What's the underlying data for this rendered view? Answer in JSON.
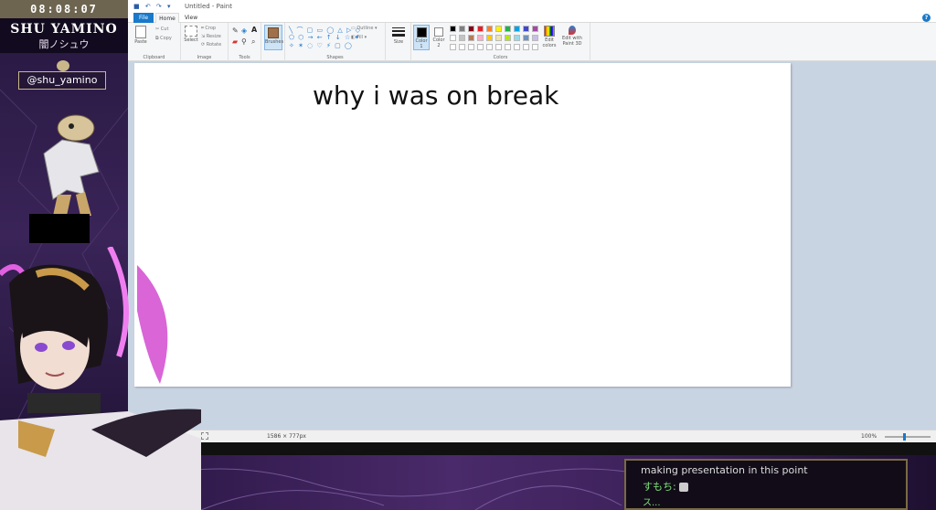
{
  "overlay": {
    "clock": "08:08:07",
    "streamer_name": "SHU YAMINO",
    "streamer_name_jp": "闇ノシュウ",
    "twitter_handle": "@shu_yamino",
    "accent_color": "#c9b78a"
  },
  "paint": {
    "title": "Untitled - Paint",
    "tabs": [
      "File",
      "Home",
      "View"
    ],
    "help_label": "?",
    "ribbon": {
      "clipboard": {
        "group": "Clipboard",
        "paste": "Paste",
        "cut": "Cut",
        "copy": "Copy"
      },
      "image": {
        "group": "Image",
        "select": "Select",
        "crop": "Crop",
        "resize": "Resize",
        "rotate": "Rotate"
      },
      "tools": {
        "group": "Tools",
        "brushes": "Brushes"
      },
      "shapes": {
        "group": "Shapes",
        "outline": "Outline",
        "fill": "Fill"
      },
      "size": {
        "label": "Size"
      },
      "colors": {
        "group": "Colors",
        "color1": "Color 1",
        "color2": "Color 2",
        "edit": "Edit colors",
        "paint3d": "Edit with Paint 3D",
        "palette": [
          "#000000",
          "#7f7f7f",
          "#880015",
          "#ed1c24",
          "#ff7f27",
          "#fff200",
          "#22b14c",
          "#00a2e8",
          "#3f48cc",
          "#a349a4",
          "#ffffff",
          "#c3c3c3",
          "#b97a57",
          "#ffaec9",
          "#ffc90e",
          "#efe4b0",
          "#b5e61d",
          "#99d9ea",
          "#7092be",
          "#c8bfe7"
        ]
      }
    },
    "canvas_text": "why i was on break",
    "status": {
      "dimensions": "1586 × 777px",
      "zoom": "100%",
      "zoom_fraction": 0.4
    }
  },
  "chat": {
    "line1": "making presentation in this point",
    "line2_user": "すもち:",
    "line3": "ス..."
  }
}
